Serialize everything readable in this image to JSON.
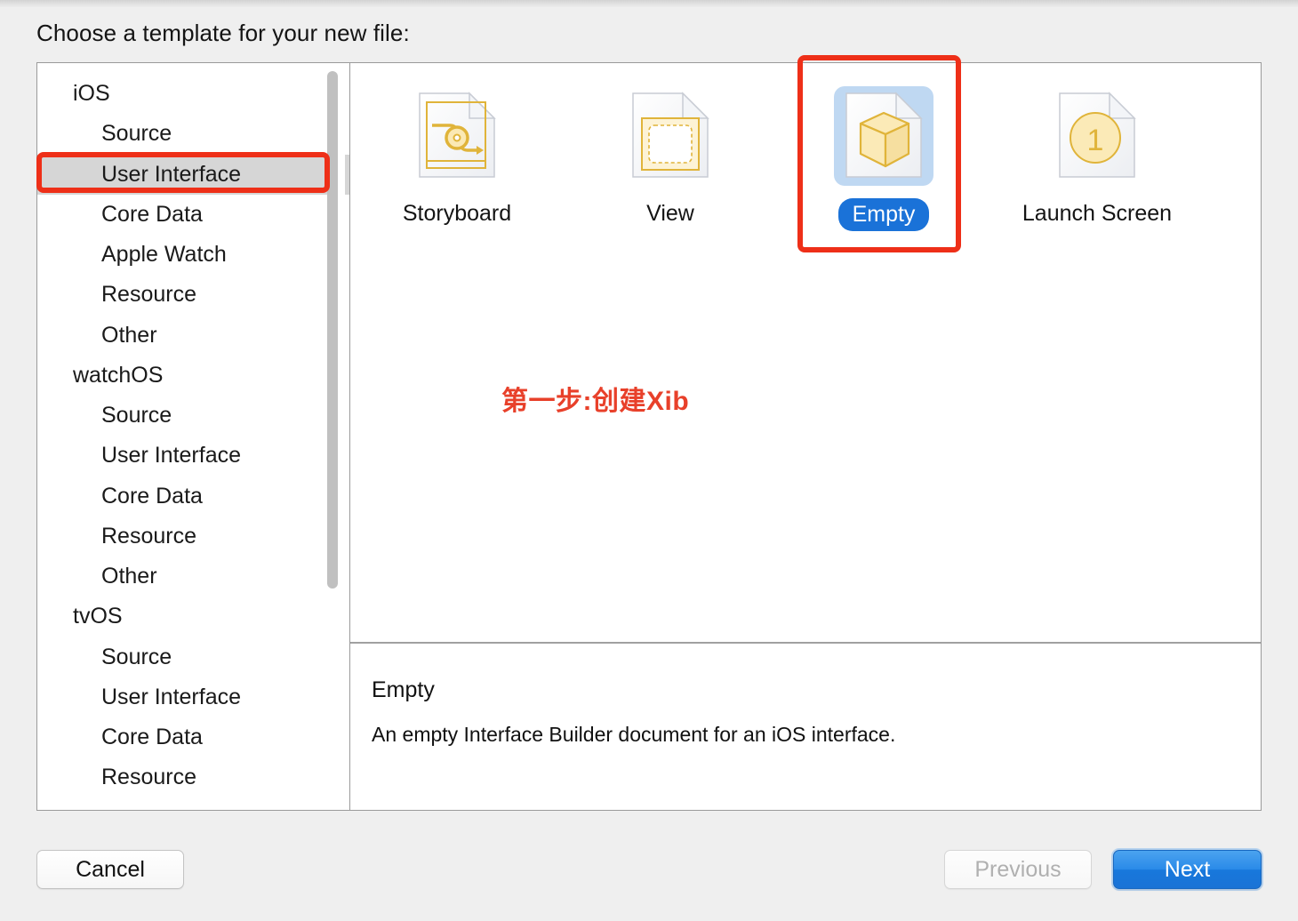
{
  "dialog": {
    "heading": "Choose a template for your new file:"
  },
  "sidebar": {
    "nodes": [
      {
        "label": "iOS",
        "type": "group",
        "selected": false
      },
      {
        "label": "Source",
        "type": "item",
        "selected": false
      },
      {
        "label": "User Interface",
        "type": "item",
        "selected": true
      },
      {
        "label": "Core Data",
        "type": "item",
        "selected": false
      },
      {
        "label": "Apple Watch",
        "type": "item",
        "selected": false
      },
      {
        "label": "Resource",
        "type": "item",
        "selected": false
      },
      {
        "label": "Other",
        "type": "item",
        "selected": false
      },
      {
        "label": "watchOS",
        "type": "group",
        "selected": false
      },
      {
        "label": "Source",
        "type": "item",
        "selected": false
      },
      {
        "label": "User Interface",
        "type": "item",
        "selected": false
      },
      {
        "label": "Core Data",
        "type": "item",
        "selected": false
      },
      {
        "label": "Resource",
        "type": "item",
        "selected": false
      },
      {
        "label": "Other",
        "type": "item",
        "selected": false
      },
      {
        "label": "tvOS",
        "type": "group",
        "selected": false
      },
      {
        "label": "Source",
        "type": "item",
        "selected": false
      },
      {
        "label": "User Interface",
        "type": "item",
        "selected": false
      },
      {
        "label": "Core Data",
        "type": "item",
        "selected": false
      },
      {
        "label": "Resource",
        "type": "item",
        "selected": false
      }
    ],
    "scrollbar": "vertical-scrollbar"
  },
  "templates": [
    {
      "label": "Storyboard",
      "icon": "storyboard-document-icon",
      "selected": false
    },
    {
      "label": "View",
      "icon": "view-document-icon",
      "selected": false
    },
    {
      "label": "Empty",
      "icon": "empty-cube-document-icon",
      "selected": true
    },
    {
      "label": "Launch Screen",
      "icon": "launch-screen-document-icon",
      "selected": false
    }
  ],
  "description": {
    "title": "Empty",
    "body": "An empty Interface Builder document for an iOS interface."
  },
  "annotation": {
    "text": "第一步:创建Xib",
    "color": "#e8402a"
  },
  "footer": {
    "cancel_label": "Cancel",
    "previous_label": "Previous",
    "next_label": "Next"
  },
  "colors": {
    "accent_blue": "#1a72d8",
    "selection_tint": "#bfd8f2",
    "annotation_red": "#ee2f18",
    "row_selection_gray": "#d6d6d6",
    "icon_gold": "#e0b43a",
    "window_bg": "#efefef"
  }
}
